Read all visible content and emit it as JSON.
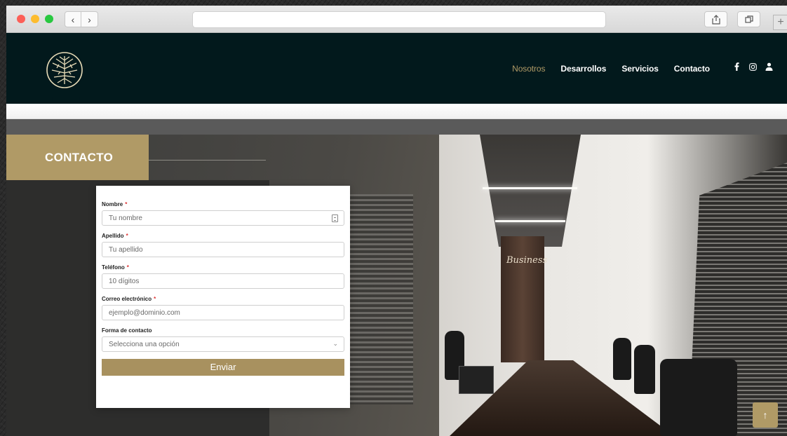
{
  "browser": {
    "back_glyph": "‹",
    "forward_glyph": "›",
    "plus_glyph": "+",
    "address_value": ""
  },
  "header": {
    "nav": [
      {
        "label": "Nosotros",
        "active": true
      },
      {
        "label": "Desarrollos",
        "active": false
      },
      {
        "label": "Servicios",
        "active": false
      },
      {
        "label": "Contacto",
        "active": false
      }
    ],
    "social_icons": [
      "facebook-icon",
      "instagram-icon",
      "user-icon"
    ]
  },
  "hero": {
    "section_title": "CONTACTO",
    "wall_sign": "Business"
  },
  "form": {
    "fields": [
      {
        "label": "Nombre",
        "required": "*",
        "placeholder": "Tu nombre"
      },
      {
        "label": "Apellido",
        "required": "*",
        "placeholder": "Tu apellido"
      },
      {
        "label": "Teléfono",
        "required": "*",
        "placeholder": "10 dígitos"
      },
      {
        "label": "Correo electrónico",
        "required": "*",
        "placeholder": "ejemplo@dominio.com"
      }
    ],
    "contact_method": {
      "label": "Forma de contacto",
      "selected": "Selecciona una opción"
    },
    "submit_label": "Enviar"
  },
  "scroll_top_glyph": "↑",
  "colors": {
    "header_bg": "#02191c",
    "accent_gold": "#b09a66",
    "nav_text": "#ffffff",
    "required_mark": "#dd3333"
  }
}
